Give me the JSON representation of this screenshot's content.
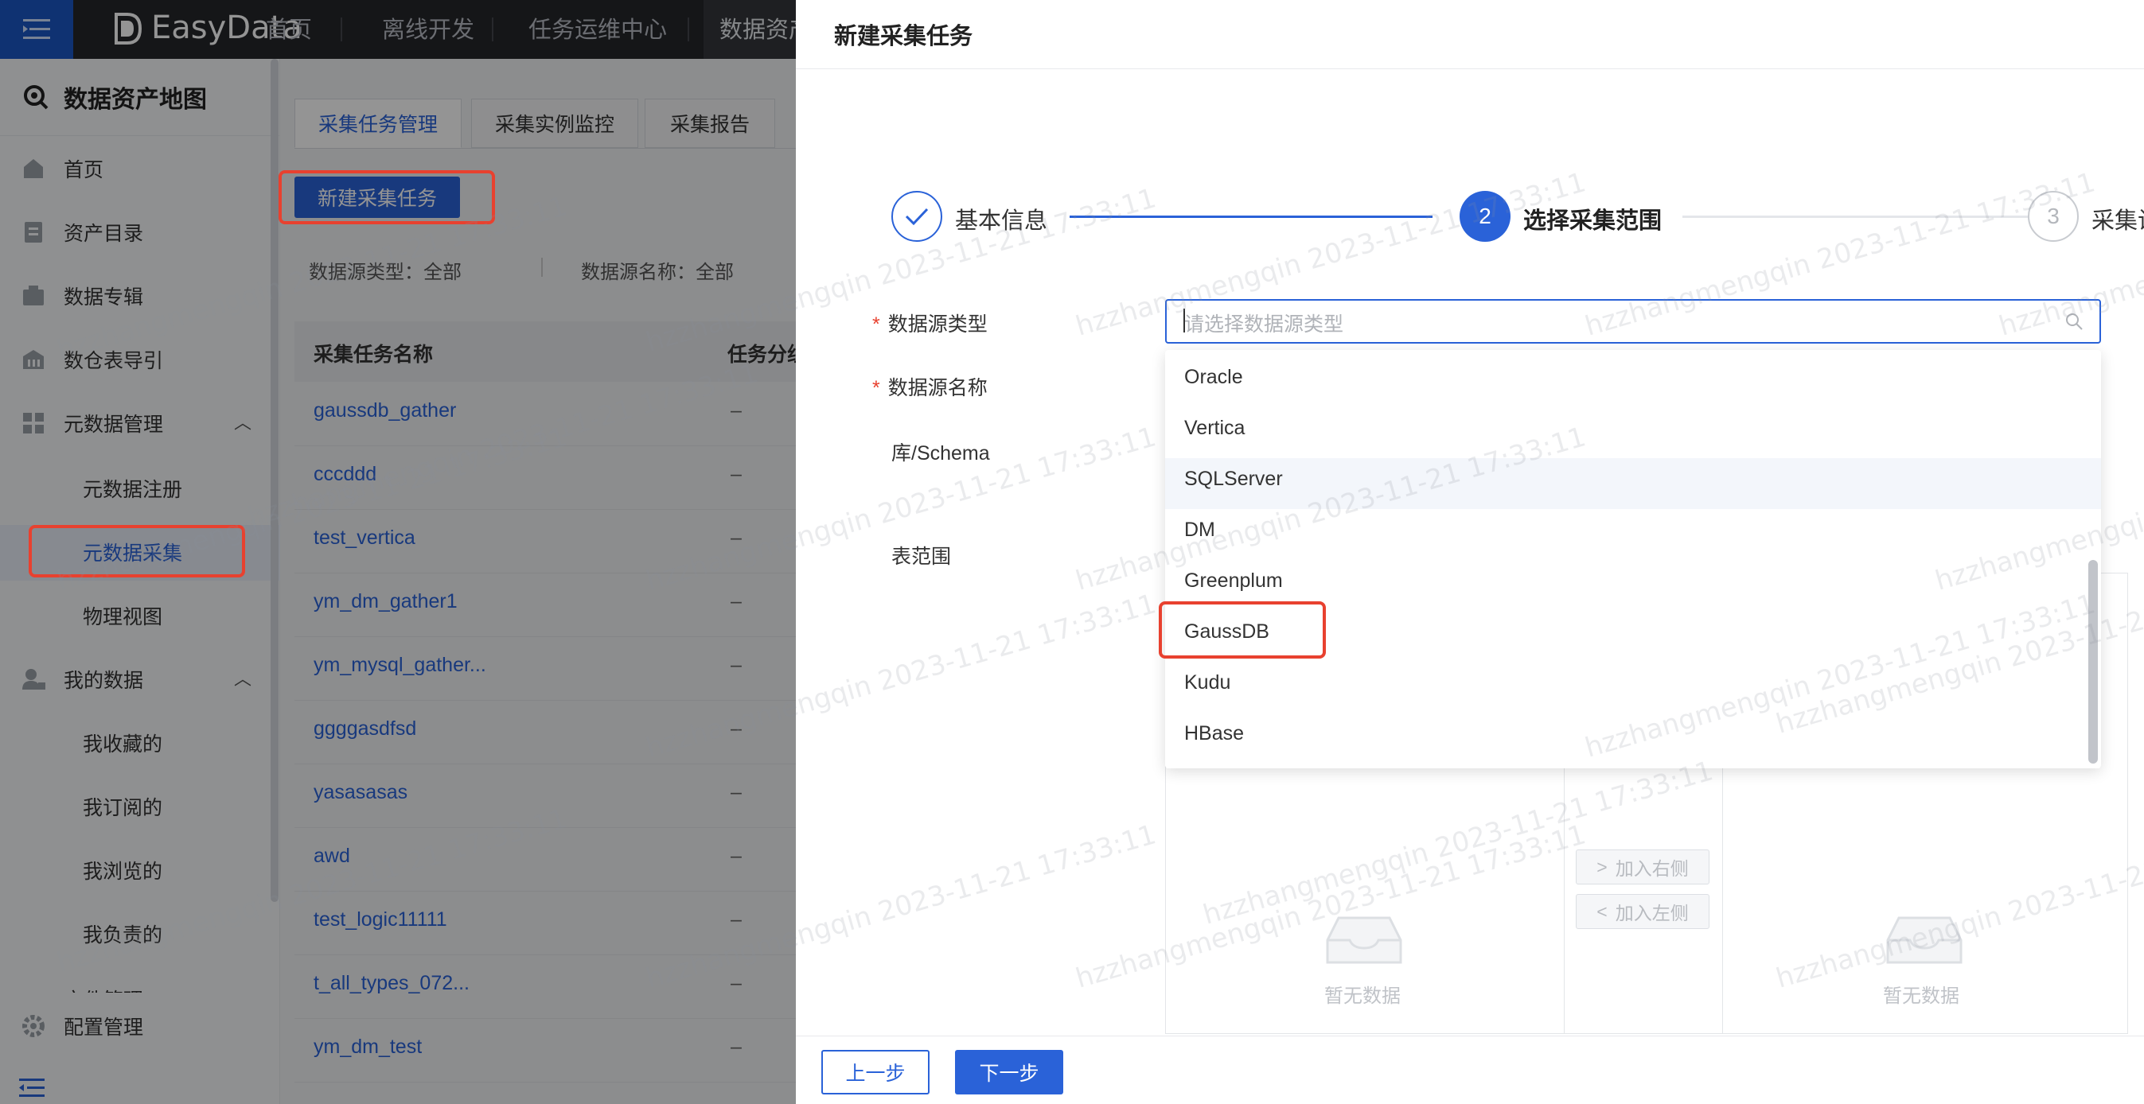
{
  "topnav": {
    "logo_text": "EasyData",
    "items": [
      "首页",
      "离线开发",
      "任务运维中心",
      "数据资产"
    ]
  },
  "sidebar": {
    "title": "数据资产地图",
    "items": [
      {
        "label": "首页",
        "icon": "home-icon"
      },
      {
        "label": "资产目录",
        "icon": "catalog-icon"
      },
      {
        "label": "数据专辑",
        "icon": "album-icon"
      },
      {
        "label": "数仓表导引",
        "icon": "warehouse-icon"
      },
      {
        "label": "元数据管理",
        "icon": "grid-icon"
      },
      {
        "label": "元数据注册"
      },
      {
        "label": "元数据采集"
      },
      {
        "label": "物理视图"
      },
      {
        "label": "我的数据",
        "icon": "user-icon"
      },
      {
        "label": "我收藏的"
      },
      {
        "label": "我订阅的"
      },
      {
        "label": "我浏览的"
      },
      {
        "label": "我负责的"
      },
      {
        "label": "文件管理"
      },
      {
        "label": "配置管理",
        "icon": "gear-icon"
      }
    ]
  },
  "list": {
    "tabs": [
      "采集任务管理",
      "采集实例监控",
      "采集报告"
    ],
    "new_button": "新建采集任务",
    "filter_type": "数据源类型：全部",
    "filter_name": "数据源名称：全部",
    "columns": [
      "采集任务名称",
      "任务分组"
    ],
    "rows": [
      {
        "name": "gaussdb_gather",
        "group": "–"
      },
      {
        "name": "cccddd",
        "group": "–"
      },
      {
        "name": "test_vertica",
        "group": "–"
      },
      {
        "name": "ym_dm_gather1",
        "group": "–"
      },
      {
        "name": "ym_mysql_gather...",
        "group": "–"
      },
      {
        "name": "ggggasdfsd",
        "group": "–"
      },
      {
        "name": "yasasasas",
        "group": "–"
      },
      {
        "name": "awd",
        "group": "–"
      },
      {
        "name": "test_logic11111",
        "group": "–"
      },
      {
        "name": "t_all_types_072...",
        "group": "–"
      },
      {
        "name": "ym_dm_test",
        "group": "–"
      }
    ]
  },
  "drawer": {
    "title": "新建采集任务",
    "steps": [
      {
        "num": "✓",
        "label": "基本信息"
      },
      {
        "num": "2",
        "label": "选择采集范围"
      },
      {
        "num": "3",
        "label": "采集设"
      }
    ],
    "form": {
      "source_type_label": "数据源类型",
      "source_type_placeholder": "请选择数据源类型",
      "source_name_label": "数据源名称",
      "schema_label": "库/Schema",
      "table_range_label": "表范围"
    },
    "dropdown_options": [
      "Oracle",
      "Vertica",
      "SQLServer",
      "DM",
      "Greenplum",
      "GaussDB",
      "Kudu",
      "HBase"
    ],
    "transfer": {
      "add_right": "加入右侧",
      "add_left": "加入左侧",
      "empty_left": "暂无数据",
      "empty_right": "暂无数据"
    },
    "footer": {
      "prev": "上一步",
      "next": "下一步"
    }
  },
  "watermark": "hzzhangmengqin 2023-11-21 17:33:11",
  "colors": {
    "accent": "#2a62d8",
    "highlight": "#e8412f",
    "nav_bg": "#25262a"
  }
}
